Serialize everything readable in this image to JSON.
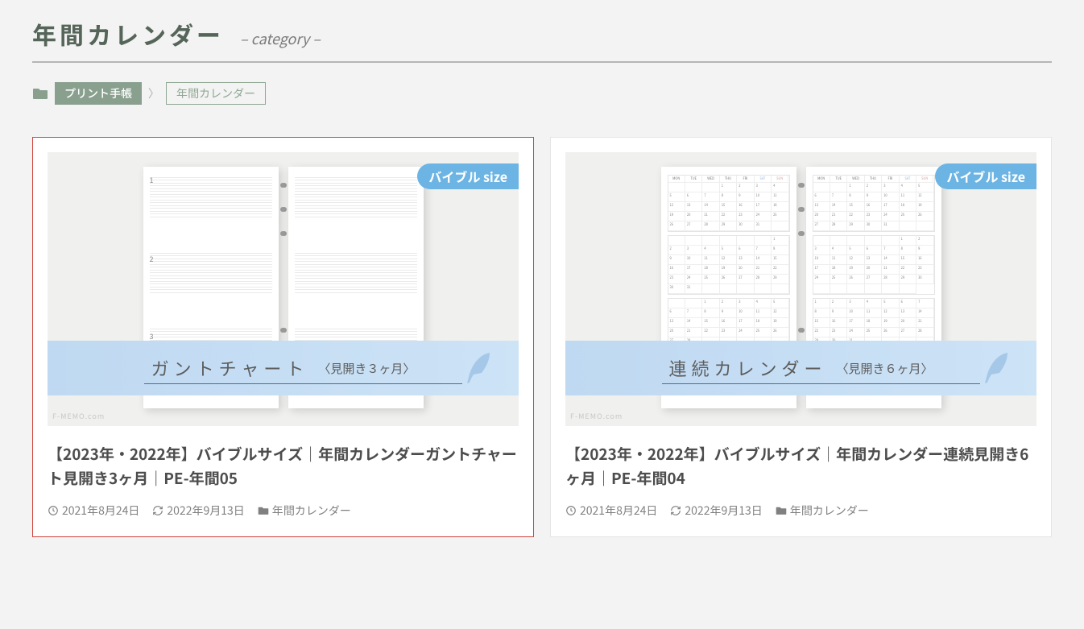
{
  "header": {
    "title": "年間カレンダー",
    "subtitle": "– category –"
  },
  "breadcrumb": {
    "items": [
      {
        "label": "プリント手帳"
      },
      {
        "label": "年間カレンダー"
      }
    ]
  },
  "badge_label": "バイブル size",
  "watermark": "F-MEMO.com",
  "cards": [
    {
      "ribbon_main": "ガントチャート",
      "ribbon_sub": "〈見開き３ヶ月〉",
      "title": "【2023年・2022年】バイブルサイズ｜年間カレンダーガントチャート見開き3ヶ月｜PE-年間05",
      "published": "2021年8月24日",
      "updated": "2022年9月13日",
      "category": "年間カレンダー"
    },
    {
      "ribbon_main": "連続カレンダー",
      "ribbon_sub": "〈見開き６ヶ月〉",
      "title": "【2023年・2022年】バイブルサイズ｜年間カレンダー連続見開き6ヶ月｜PE-年間04",
      "published": "2021年8月24日",
      "updated": "2022年9月13日",
      "category": "年間カレンダー"
    }
  ]
}
